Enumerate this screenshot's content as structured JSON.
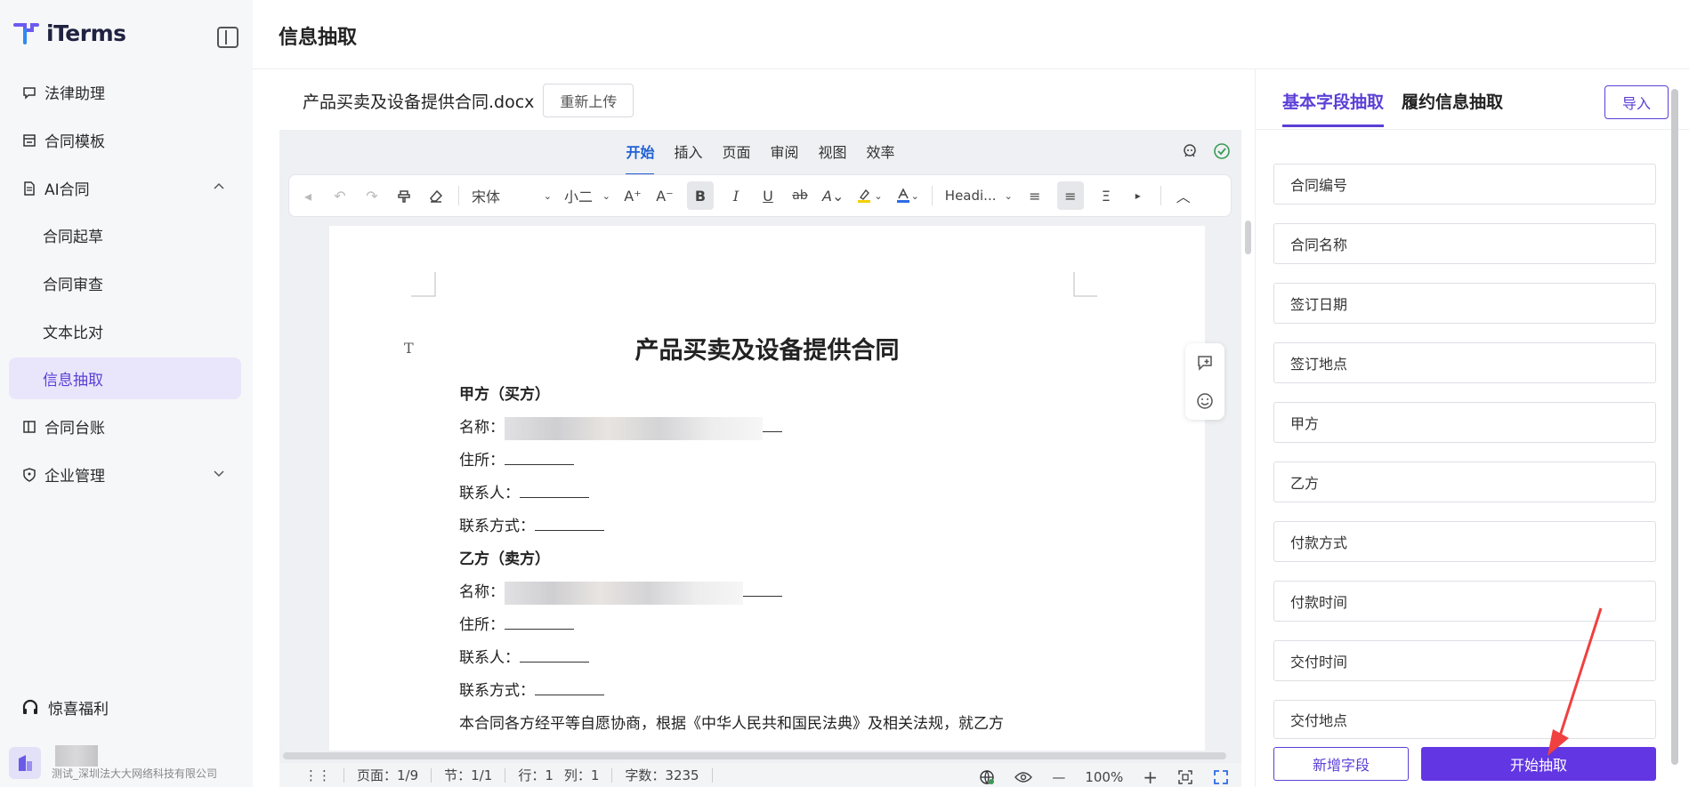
{
  "app": {
    "name": "iTerms"
  },
  "sidebar": {
    "items": [
      {
        "label": "法律助理",
        "icon": "chat-icon"
      },
      {
        "label": "合同模板",
        "icon": "template-icon"
      },
      {
        "label": "AI合同",
        "icon": "document-icon",
        "expanded": true
      },
      {
        "label": "合同起草"
      },
      {
        "label": "合同审查"
      },
      {
        "label": "文本比对"
      },
      {
        "label": "信息抽取",
        "active": true
      },
      {
        "label": "合同台账",
        "icon": "ledger-icon"
      },
      {
        "label": "企业管理",
        "icon": "shield-icon",
        "expanded": false
      }
    ],
    "gift": "惊喜福利",
    "company": "测试_深圳法大大网络科技有限公司"
  },
  "header": {
    "title": "信息抽取"
  },
  "file": {
    "name": "产品买卖及设备提供合同.docx",
    "reupload": "重新上传"
  },
  "editor": {
    "menu": [
      "开始",
      "插入",
      "页面",
      "审阅",
      "视图",
      "效率"
    ],
    "font": "宋体",
    "size": "小二",
    "style": "Headi...",
    "doc": {
      "title": "产品买卖及设备提供合同",
      "party_a": "甲方（买方）",
      "party_b": "乙方（卖方）",
      "name": "名称：",
      "address": "住所：",
      "contact": "联系人：",
      "contact_way": "联系方式：",
      "intro": "本合同各方经平等自愿协商，根据《中华人民共和国民法典》及相关法规，就乙方"
    },
    "status": {
      "page": "页面：1/9",
      "section": "节：1/1",
      "row": "行：1",
      "col": "列：1",
      "words": "字数：3235",
      "zoom": "100%"
    }
  },
  "panel": {
    "tabs": [
      "基本字段抽取",
      "履约信息抽取"
    ],
    "import": "导入",
    "fields": [
      "合同编号",
      "合同名称",
      "签订日期",
      "签订地点",
      "甲方",
      "乙方",
      "付款方式",
      "付款时间",
      "交付时间",
      "交付地点"
    ],
    "add": "新增字段",
    "start": "开始抽取"
  },
  "colors": {
    "accent": "#6236e3",
    "tab_blue": "#1f5fd6"
  }
}
